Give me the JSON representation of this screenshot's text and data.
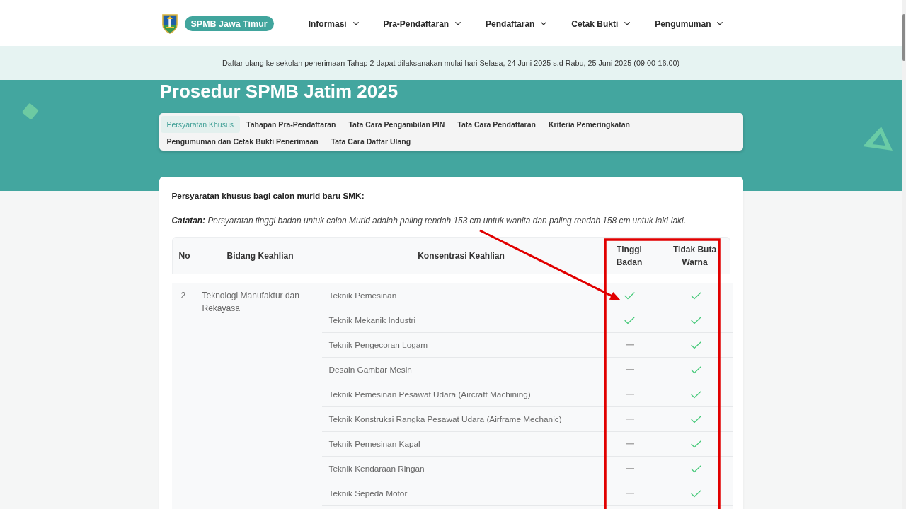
{
  "header": {
    "brand": "SPMB Jawa Timur",
    "nav": [
      {
        "label": "Informasi"
      },
      {
        "label": "Pra-Pendaftaran"
      },
      {
        "label": "Pendaftaran"
      },
      {
        "label": "Cetak Bukti"
      },
      {
        "label": "Pengumuman"
      }
    ]
  },
  "announcement": "Daftar ulang ke sekolah penerimaan Tahap 2 dapat dilaksanakan mulai hari Selasa, 24 Juni 2025 s.d Rabu, 25 Juni 2025 (09.00-16.00)",
  "page_title": "Prosedur SPMB Jatim 2025",
  "tabs": [
    {
      "label": "Persyaratan Khusus",
      "selected": true
    },
    {
      "label": "Tahapan Pra-Pendaftaran",
      "selected": false
    },
    {
      "label": "Tata Cara Pengambilan PIN",
      "selected": false
    },
    {
      "label": "Tata Cara Pendaftaran",
      "selected": false
    },
    {
      "label": "Kriteria Pemeringkatan",
      "selected": false
    },
    {
      "label": "Pengumuman dan Cetak Bukti Penerimaan",
      "selected": false
    },
    {
      "label": "Tata Cara Daftar Ulang",
      "selected": false
    }
  ],
  "content": {
    "heading": "Persyaratan khusus bagi calon murid baru SMK:",
    "note": "**Catatan:** Persyaratan tinggi badan untuk calon Murid adalah paling rendah 153 cm untuk wanita dan paling rendah 158 cm untuk laki-laki."
  },
  "table": {
    "columns": [
      "No",
      "Bidang Keahlian",
      "Konsentrasi Keahlian",
      "Tinggi Badan",
      "Tidak Buta Warna"
    ],
    "groups": [
      {
        "no": "2",
        "bidang": "Teknologi Manufaktur dan Rekayasa",
        "rows": [
          {
            "konsentrasi": "Teknik Pemesinan",
            "tinggi_badan": true,
            "tidak_buta_warna": true
          },
          {
            "konsentrasi": "Teknik Mekanik Industri",
            "tinggi_badan": true,
            "tidak_buta_warna": true
          },
          {
            "konsentrasi": "Teknik Pengecoran Logam",
            "tinggi_badan": false,
            "tidak_buta_warna": true
          },
          {
            "konsentrasi": "Desain Gambar Mesin",
            "tinggi_badan": false,
            "tidak_buta_warna": true
          },
          {
            "konsentrasi": "Teknik Pemesinan Pesawat Udara (Aircraft Machining)",
            "tinggi_badan": false,
            "tidak_buta_warna": true
          },
          {
            "konsentrasi": "Teknik Konstruksi Rangka Pesawat Udara (Airframe Mechanic)",
            "tinggi_badan": false,
            "tidak_buta_warna": true
          },
          {
            "konsentrasi": "Teknik Pemesinan Kapal",
            "tinggi_badan": false,
            "tidak_buta_warna": true
          },
          {
            "konsentrasi": "Teknik Kendaraan Ringan",
            "tinggi_badan": false,
            "tidak_buta_warna": true
          },
          {
            "konsentrasi": "Teknik Sepeda Motor",
            "tinggi_badan": false,
            "tidak_buta_warna": true
          }
        ]
      }
    ]
  },
  "annotations": [
    {
      "kind": "highlight-rectangle"
    },
    {
      "kind": "arrow"
    }
  ]
}
